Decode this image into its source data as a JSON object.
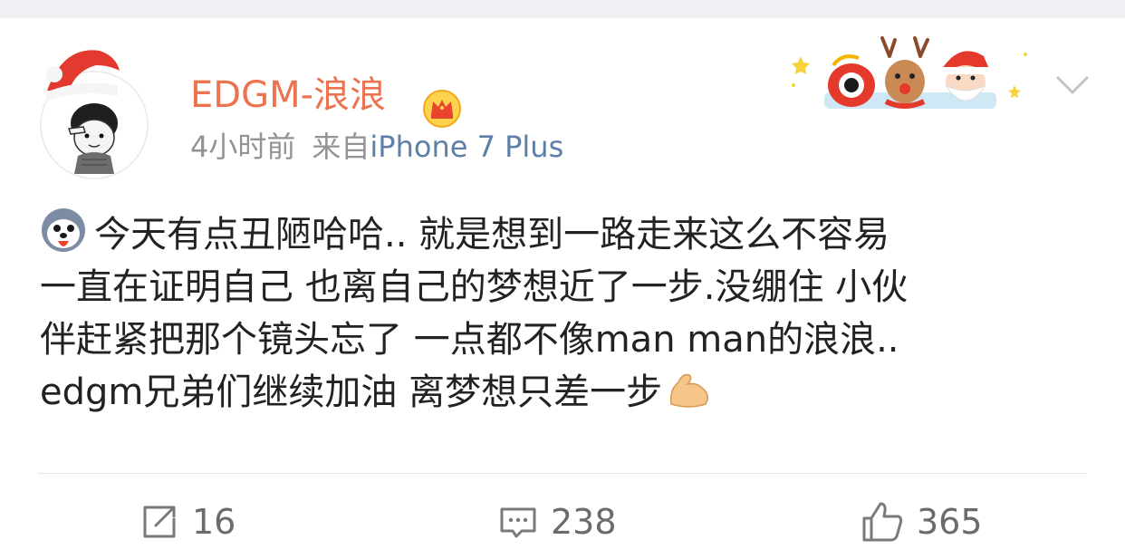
{
  "user": {
    "name": "EDGM-浪浪",
    "time": "4小时前",
    "source_prefix": "来自",
    "source_device": "iPhone 7 Plus"
  },
  "post": {
    "lines": [
      "今天有点丑陋哈哈.. 就是想到一路走来这么不容易",
      "一直在证明自己 也离自己的梦想近了一步.没绷住 小伙",
      "伴赶紧把那个镜头忘了 一点都不像man man的浪浪..",
      "edgm兄弟们继续加油 离梦想只差一步"
    ]
  },
  "actions": {
    "repost_count": "16",
    "comment_count": "238",
    "like_count": "365"
  },
  "icons": {
    "crown": "vip-crown-icon",
    "chevron": "chevron-down-icon",
    "repost": "repost-icon",
    "comment": "comment-icon",
    "like": "thumbs-up-icon",
    "emoji_lead": "husky-tongue-emoji",
    "emoji_tail": "flexed-biceps-emoji"
  },
  "colors": {
    "username": "#eb7350",
    "meta": "#939393",
    "source_link": "#5d7fa8",
    "body_text": "#222222",
    "action_text": "#6b6b6b",
    "background": "#ffffff",
    "top_strip": "#efeff4"
  }
}
